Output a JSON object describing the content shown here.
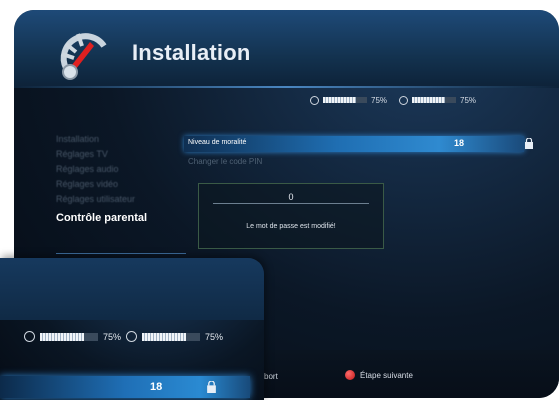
{
  "header": {
    "title": "Installation"
  },
  "signal": {
    "strength_label": "75%",
    "strength_level": 0.75,
    "quality_label": "75%",
    "quality_level": 0.75
  },
  "menu": {
    "items": [
      "Installation",
      "Réglages TV",
      "Réglages audio",
      "Réglages vidéo",
      "Réglages utilisateur"
    ],
    "active_item": "Contrôle parental"
  },
  "content": {
    "level_label": "Niveau de moralité",
    "level_value": "18",
    "pin_label": "Changer le code PIN",
    "dialog_value": "0",
    "dialog_message": "Le mot de passe est modifié!"
  },
  "footer": {
    "left_label": "bort",
    "next_label": "Étape suivante"
  },
  "colors": {
    "accent": "#2d7fc8",
    "highlight": "#1f6eb2",
    "next": "#d11f1f"
  }
}
